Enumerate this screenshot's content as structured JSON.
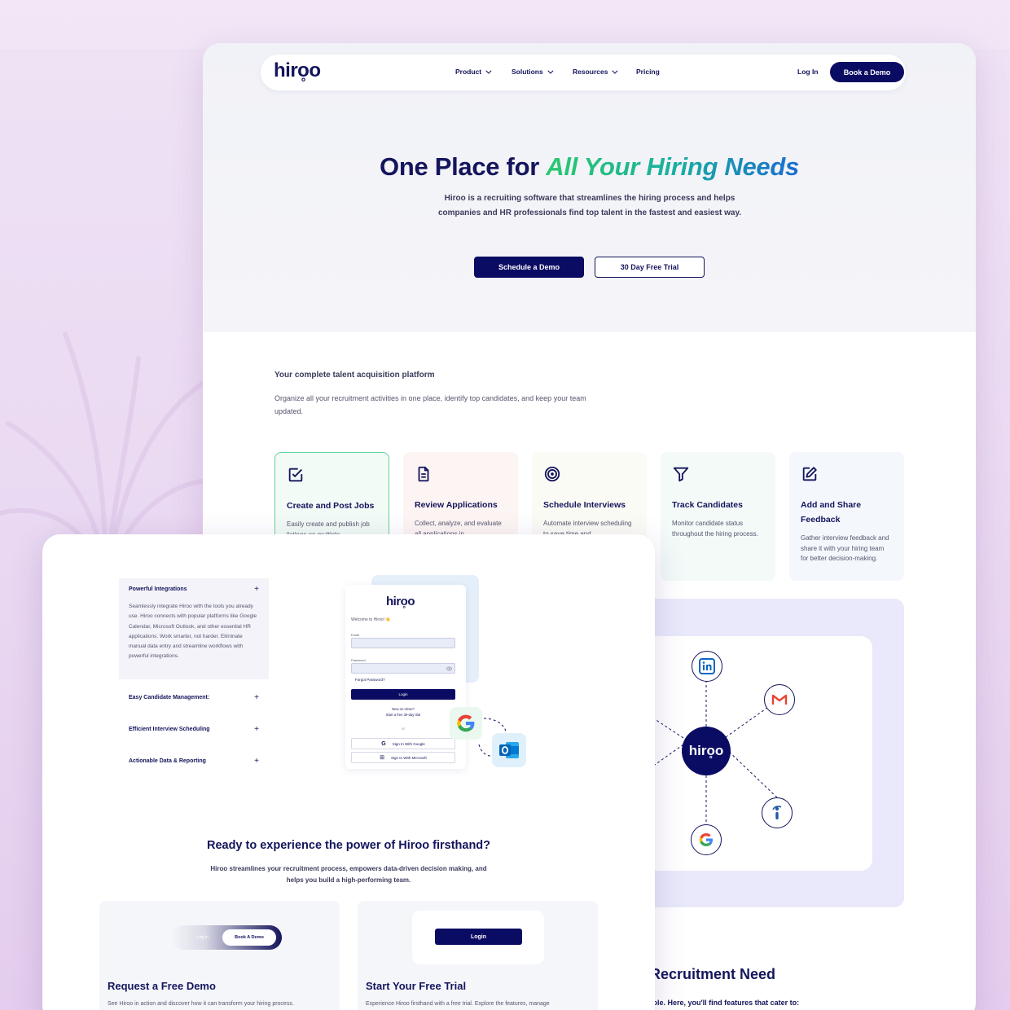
{
  "brand": {
    "logo_text": "hiro̥o",
    "navy": "#0a0b63",
    "accent_gradient": [
      "#2bc86d",
      "#1a6bd0"
    ]
  },
  "nav": {
    "items": [
      {
        "label": "Product",
        "has_dropdown": true
      },
      {
        "label": "Solutions",
        "has_dropdown": true
      },
      {
        "label": "Resources",
        "has_dropdown": true
      },
      {
        "label": "Pricing",
        "has_dropdown": false
      }
    ],
    "login": "Log In",
    "cta": "Book a Demo"
  },
  "hero": {
    "title_prefix": "One Place for ",
    "title_highlight": "All Your Hiring Needs",
    "subtitle": "Hiroo is a recruiting software that streamlines the hiring process and helps companies and HR professionals find top talent in the fastest and easiest way.",
    "primary_button": "Schedule a Demo",
    "secondary_button": "30 Day Free Trial"
  },
  "platform": {
    "title": "Your complete talent acquisition platform",
    "description": "Organize all your recruitment activities in one place, identify top candidates, and keep your team updated."
  },
  "features": [
    {
      "title": "Create and Post Jobs",
      "desc": "Easily create and publish job listings on multiple",
      "icon": "checkbox-icon",
      "bg": "#f2fbf6",
      "border": "#5fd49a"
    },
    {
      "title": "Review Applications",
      "desc": "Collect, analyze, and evaluate all applications in",
      "icon": "document-icon",
      "bg": "#fdf5f3",
      "border": ""
    },
    {
      "title": "Schedule Interviews",
      "desc": "Automate interview scheduling to save time and",
      "icon": "target-icon",
      "bg": "#fbfbf5",
      "border": ""
    },
    {
      "title": "Track Candidates",
      "desc": "Monitor candidate status throughout the hiring process.",
      "icon": "filter-icon",
      "bg": "#f3faf8",
      "border": ""
    },
    {
      "title": "Add and Share Feedback",
      "desc": "Gather interview feedback and share it with your hiring team for better decision-making.",
      "icon": "edit-icon",
      "bg": "#f4f7fc",
      "border": ""
    }
  ],
  "integrations": {
    "hub_label": "hiro̥o",
    "satellites": [
      "linkedin-icon",
      "gmail-icon",
      "indeed-icon",
      "google-icon"
    ]
  },
  "recruitment": {
    "title": "Recruitment Need",
    "subtitle": "role. Here, you'll find features that cater to:"
  },
  "accordion": {
    "items": [
      {
        "title": "Powerful Integrations",
        "expanded": true,
        "body": "Seamlessly integrate Hiroo with the tools you already use. Hiroo connects with popular platforms like Google Calendar, Microsoft Outlook, and other essential HR applications. Work smarter, not harder. Eliminate manual data entry and streamline workflows with powerful integrations."
      },
      {
        "title": "Easy Candidate Management:",
        "expanded": false,
        "body": ""
      },
      {
        "title": "Efficient Interview Scheduling",
        "expanded": false,
        "body": ""
      },
      {
        "title": "Actionable Data & Reporting",
        "expanded": false,
        "body": ""
      }
    ],
    "plus": "+"
  },
  "login_mock": {
    "logo": "hiro̥o",
    "welcome": "Welcome to Hiroo! 👋",
    "email_label": "Email",
    "password_label": "Password",
    "forgot": "Forgot Password?",
    "login_button": "Login",
    "new_line1": "New on Hiroo?",
    "new_line2": "Start a free 30-day trial",
    "or": "or",
    "google_sso": "Sign In With Google",
    "microsoft_sso": "Sign In With Microsoft"
  },
  "cta": {
    "title": "Ready to experience the power of Hiroo firsthand?",
    "subtitle": "Hiroo streamlines your recruitment process, empowers data-driven decision making, and helps you build a high-performing team.",
    "demo_card": {
      "pill_login": "Log In",
      "pill_demo": "Book A Demo",
      "title": "Request a Free Demo",
      "desc": "See Hiroo in action and discover how it can transform your hiring process."
    },
    "trial_card": {
      "button": "Login",
      "title": "Start Your Free Trial",
      "desc": "Experience Hiroo firsthand with a free trial. Explore the features, manage"
    }
  }
}
